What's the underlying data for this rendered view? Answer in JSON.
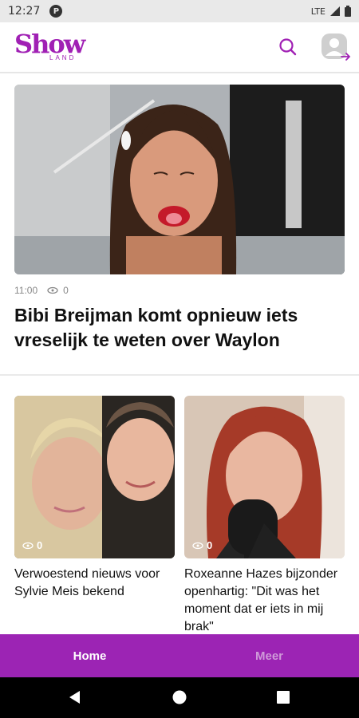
{
  "status_bar": {
    "time": "12:27",
    "network": "LTE",
    "notification_icon": "p-badge-icon"
  },
  "app": {
    "logo_main": "Show",
    "logo_sub": "LAND",
    "brand_color": "#a020b4"
  },
  "hero": {
    "time": "11:00",
    "views": "0",
    "headline": "Bibi Breijman komt opnieuw iets vreselijk te weten over Waylon"
  },
  "cards": [
    {
      "views": "0",
      "title": "Verwoestend nieuws voor Sylvie Meis bekend"
    },
    {
      "views": "0",
      "title": "Roxeanne Hazes bijzonder openhartig: \"Dit was het moment dat er iets in mij brak\""
    }
  ],
  "bottom_nav": {
    "home": "Home",
    "more": "Meer",
    "active_color": "#ffffff",
    "inactive_color": "#cf9ad9",
    "bar_color": "#9c24b4"
  }
}
